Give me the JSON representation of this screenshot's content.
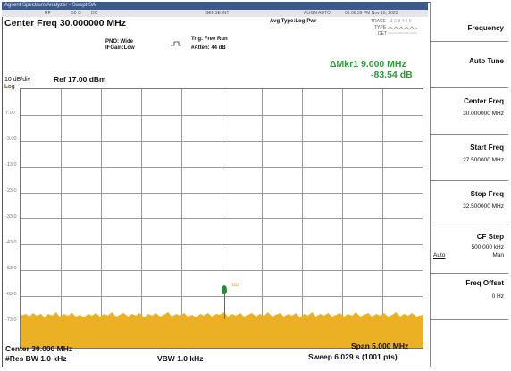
{
  "window": {
    "title": "Agilent Spectrum Analyzer - Swept SA",
    "status_rf": "RF",
    "status_ohms": "50 Ω",
    "status_coupling": "DC",
    "status_sense": "SENSE:INT",
    "status_align": "ALIGN AUTO",
    "status_datetime": "01:06:39 PM Nov 16, 2022"
  },
  "header": {
    "center_freq": "Center Freq 30.000000 MHz",
    "pno": "PNO: Wide",
    "ifgain": "IFGain:Low",
    "trig": "Trig: Free Run",
    "atten": "#Atten: 44 dB",
    "avg_type": "Avg Type:Log-Pwr",
    "trace_label": "TRACE",
    "trace_nums": "1 2 3 4 5 6",
    "type_label": "TYPE",
    "det_label": "DET",
    "marker_delta": "ΔMkr1 9.000 MHz",
    "marker_level": "-83.54 dB"
  },
  "scale": {
    "per_div": "10 dB/div",
    "ref": "Ref 17.00 dBm",
    "log": "Log",
    "y_labels": [
      "7.00",
      "-3.00",
      "-13.0",
      "-23.0",
      "-33.0",
      "-43.0",
      "-53.0",
      "-63.0",
      "-73.0"
    ]
  },
  "marker": {
    "tag": "1Δ2",
    "level": "-63.0"
  },
  "footer": {
    "center": "Center 30.000 MHz",
    "res_bw": "#Res BW 1.0 kHz",
    "vbw": "VBW 1.0 kHz",
    "span": "Span 5.000 MHz",
    "sweep": "Sweep  6.029 s (1001 pts)"
  },
  "softkeys": {
    "menu_title": "Frequency",
    "auto_tune": "Auto Tune",
    "center_freq_label": "Center Freq",
    "center_freq_val": "30.000000 MHz",
    "start_freq_label": "Start Freq",
    "start_freq_val": "27.500000 MHz",
    "stop_freq_label": "Stop Freq",
    "stop_freq_val": "32.500000 MHz",
    "cf_step_label": "CF Step",
    "cf_step_val": "500.000 kHz",
    "cf_step_auto": "Auto",
    "cf_step_man": "Man",
    "freq_offset_label": "Freq Offset",
    "freq_offset_val": "0 Hz"
  },
  "colors": {
    "trace": "#ecb024",
    "marker": "#2a8a35",
    "delta_text": "#2e9a3a",
    "titlebar": "#3c5a8c"
  }
}
